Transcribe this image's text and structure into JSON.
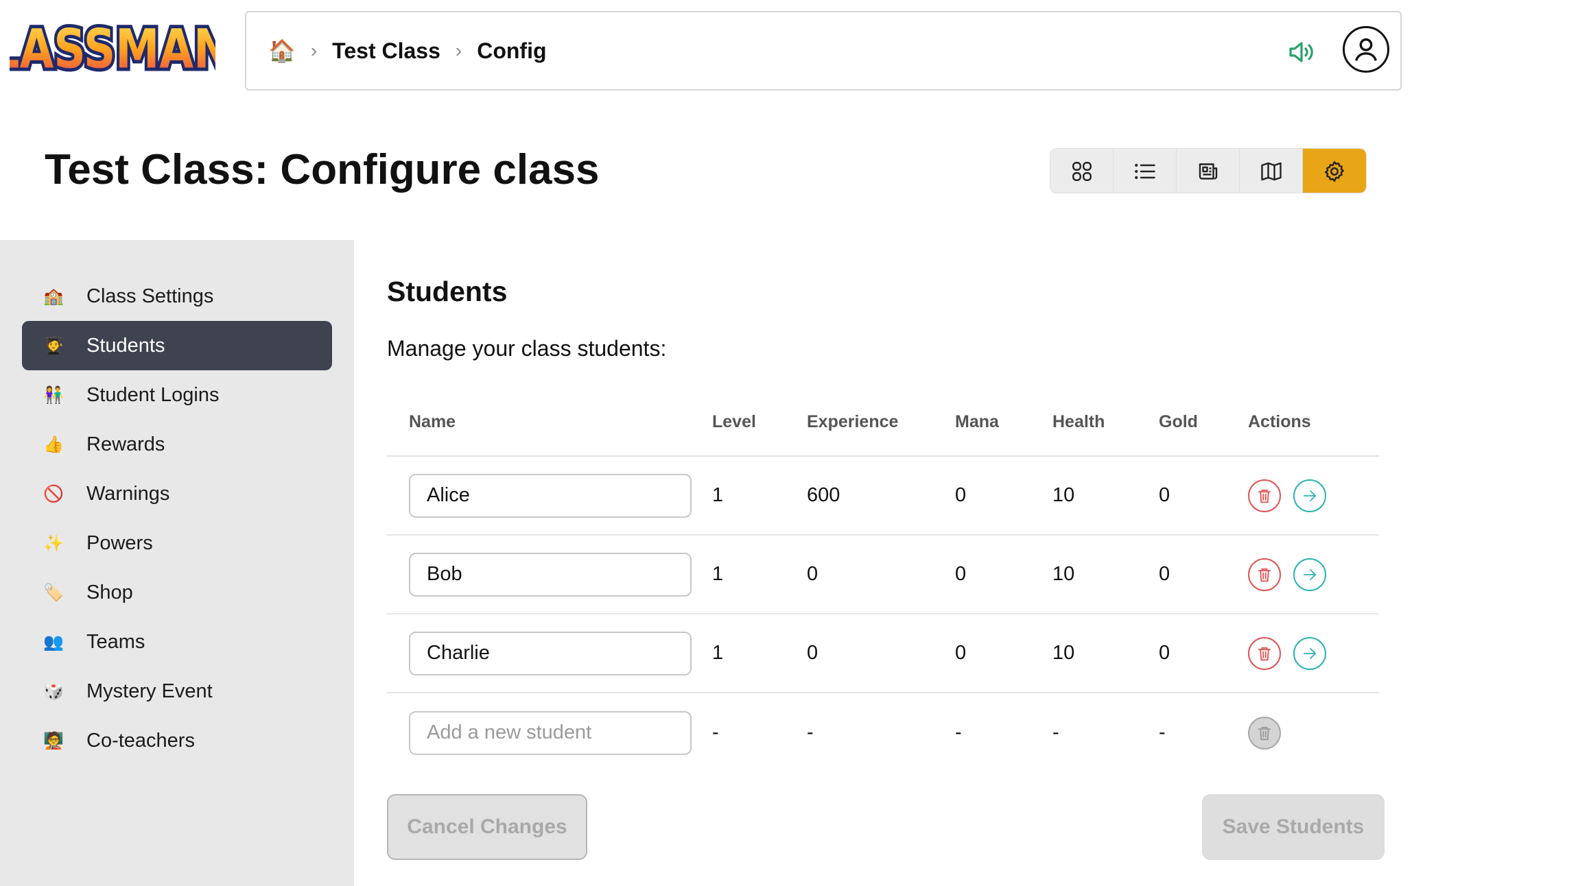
{
  "app": {
    "logo_text": "CLASSMANA"
  },
  "breadcrumb": {
    "home_icon": "🏠",
    "items": [
      "Test Class",
      "Config"
    ]
  },
  "header": {
    "speaker_icon": "speaker-icon",
    "profile_icon": "user-icon"
  },
  "page": {
    "title": "Test Class: Configure class"
  },
  "views": [
    {
      "icon": "grid-icon",
      "active": false
    },
    {
      "icon": "list-icon",
      "active": false
    },
    {
      "icon": "newspaper-icon",
      "active": false
    },
    {
      "icon": "map-icon",
      "active": false
    },
    {
      "icon": "gear-icon",
      "active": true
    }
  ],
  "sidebar": {
    "items": [
      {
        "emoji": "🏫",
        "label": "Class Settings"
      },
      {
        "emoji": "🧑‍🎓",
        "label": "Students",
        "active": true
      },
      {
        "emoji": "👫",
        "label": "Student Logins"
      },
      {
        "emoji": "👍",
        "label": "Rewards"
      },
      {
        "emoji": "🚫",
        "label": "Warnings"
      },
      {
        "emoji": "✨",
        "label": "Powers"
      },
      {
        "emoji": "🏷️",
        "label": "Shop"
      },
      {
        "emoji": "👥",
        "label": "Teams"
      },
      {
        "emoji": "🎲",
        "label": "Mystery Event"
      },
      {
        "emoji": "🧑‍🏫",
        "label": "Co-teachers"
      }
    ]
  },
  "main": {
    "section_title": "Students",
    "description": "Manage your class students:",
    "columns": [
      "Name",
      "Level",
      "Experience",
      "Mana",
      "Health",
      "Gold",
      "Actions"
    ],
    "students": [
      {
        "name": "Alice",
        "level": "1",
        "experience": "600",
        "mana": "0",
        "health": "10",
        "gold": "0"
      },
      {
        "name": "Bob",
        "level": "1",
        "experience": "0",
        "mana": "0",
        "health": "10",
        "gold": "0"
      },
      {
        "name": "Charlie",
        "level": "1",
        "experience": "0",
        "mana": "0",
        "health": "10",
        "gold": "0"
      }
    ],
    "new_row": {
      "placeholder": "Add a new student",
      "level": "-",
      "experience": "-",
      "mana": "-",
      "health": "-",
      "gold": "-"
    },
    "cancel_label": "Cancel Changes",
    "save_label": "Save Students"
  },
  "colors": {
    "accent": "#e8a516",
    "sidebar_active": "#3f4350",
    "delete": "#e05555",
    "go": "#2bb3b3",
    "speaker": "#2aa06b"
  }
}
